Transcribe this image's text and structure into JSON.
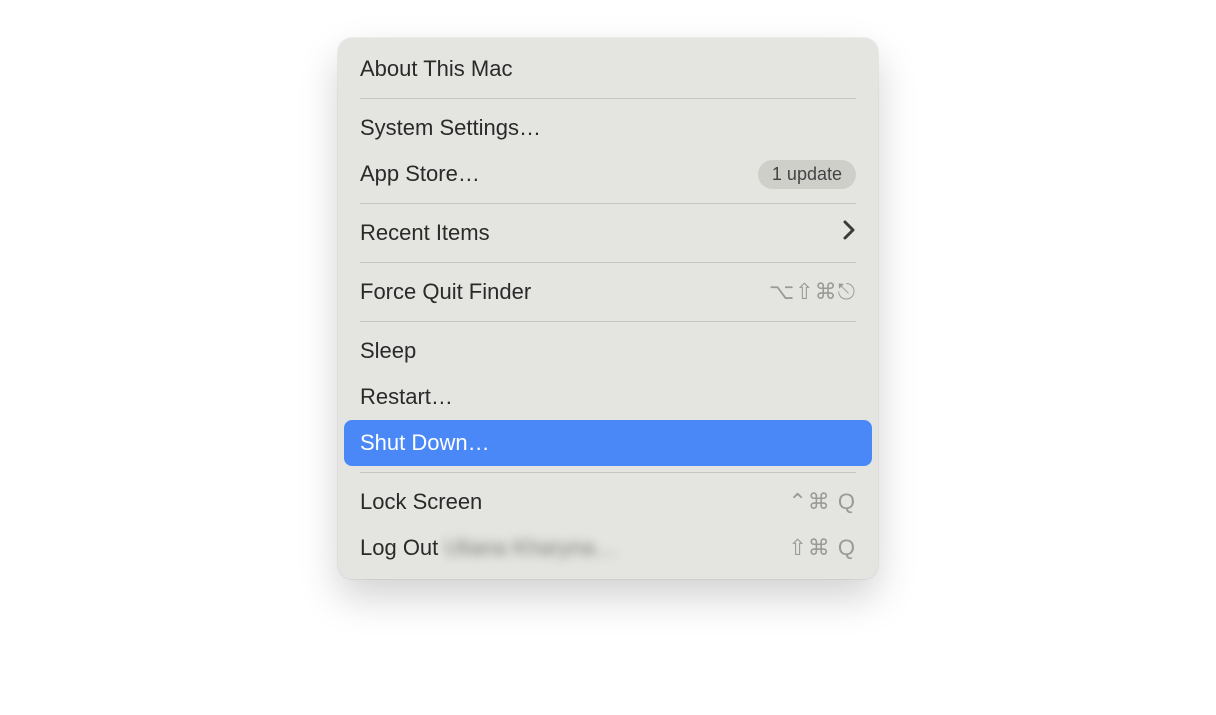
{
  "menu": {
    "about": "About This Mac",
    "systemSettings": "System Settings…",
    "appStore": "App Store…",
    "appStoreBadge": "1 update",
    "recentItems": "Recent Items",
    "forceQuit": "Force Quit Finder",
    "forceQuitShortcut": "⌥⇧⌘⎋",
    "sleep": "Sleep",
    "restart": "Restart…",
    "shutDown": "Shut Down…",
    "lockScreen": "Lock Screen",
    "lockScreenShortcut": "⌃⌘ Q",
    "logOut": "Log Out",
    "logOutUser": "Uliana Kharyna…",
    "logOutShortcut": "⇧⌘ Q"
  }
}
